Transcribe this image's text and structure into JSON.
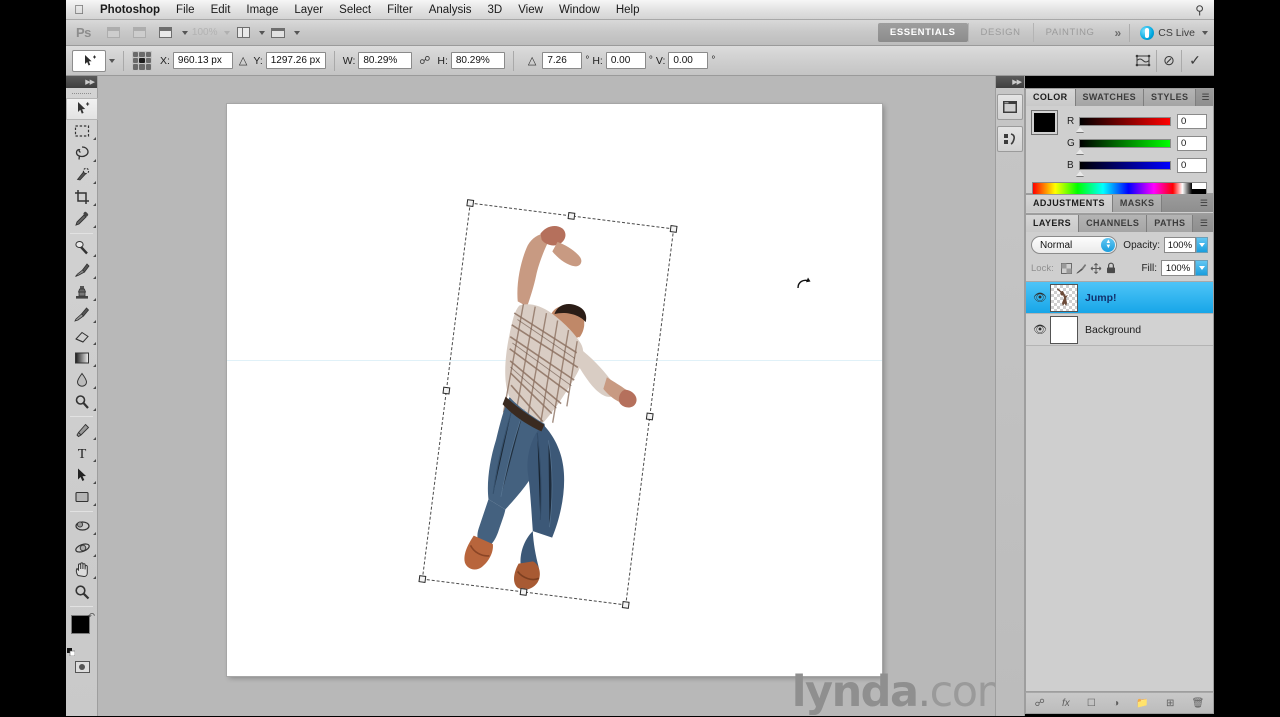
{
  "menubar": {
    "apple": "apple-logo",
    "items": [
      "Photoshop",
      "File",
      "Edit",
      "Image",
      "Layer",
      "Select",
      "Filter",
      "Analysis",
      "3D",
      "View",
      "Window",
      "Help"
    ],
    "spotlight": "search-icon"
  },
  "appbar": {
    "logo": "Ps",
    "zoom_value": "100%",
    "workspaces": [
      "ESSENTIALS",
      "DESIGN",
      "PAINTING"
    ],
    "active_workspace": "ESSENTIALS",
    "more": "»",
    "cs_live": "CS Live"
  },
  "options": {
    "x_label": "X:",
    "x_value": "960.13 px",
    "y_label": "Y:",
    "y_value": "1297.26 px",
    "w_label": "W:",
    "w_value": "80.29%",
    "h_label": "H:",
    "h_value": "80.29%",
    "angle_value": "7.26",
    "angle_unit": "°",
    "skew_h_label": "H:",
    "skew_h_value": "0.00",
    "skew_h_unit": "°",
    "skew_v_label": "V:",
    "skew_v_value": "0.00",
    "skew_v_unit": "°",
    "delta_symbol": "△",
    "warp_icon": "warp-icon",
    "cancel_icon": "⊘",
    "commit_icon": "✓"
  },
  "tools": [
    {
      "name": "move-tool",
      "selected": true
    },
    {
      "name": "rectangular-marquee-tool",
      "selected": false
    },
    {
      "name": "lasso-tool",
      "selected": false
    },
    {
      "name": "quick-selection-tool",
      "selected": false
    },
    {
      "name": "crop-tool",
      "selected": false
    },
    {
      "name": "eyedropper-tool",
      "selected": false
    },
    {
      "name": "spot-healing-brush-tool",
      "selected": false
    },
    {
      "name": "brush-tool",
      "selected": false
    },
    {
      "name": "clone-stamp-tool",
      "selected": false
    },
    {
      "name": "history-brush-tool",
      "selected": false
    },
    {
      "name": "eraser-tool",
      "selected": false
    },
    {
      "name": "gradient-tool",
      "selected": false
    },
    {
      "name": "blur-tool",
      "selected": false
    },
    {
      "name": "dodge-tool",
      "selected": false
    },
    {
      "name": "pen-tool",
      "selected": false
    },
    {
      "name": "type-tool",
      "selected": false,
      "glyph": "T"
    },
    {
      "name": "path-selection-tool",
      "selected": false
    },
    {
      "name": "rectangle-shape-tool",
      "selected": false
    },
    {
      "name": "3d-rotate-tool",
      "selected": false
    },
    {
      "name": "3d-orbit-tool",
      "selected": false
    },
    {
      "name": "hand-tool",
      "selected": false
    },
    {
      "name": "zoom-tool",
      "selected": false
    }
  ],
  "toolbox": {
    "foreground_color": "#000000",
    "background_color": "#ffffff",
    "quick_mask": "quick-mask-icon"
  },
  "canvas": {
    "transform_angle_deg": 7.26,
    "watermark_brand": "lynda",
    "watermark_dot": ".",
    "watermark_tld": "com"
  },
  "dock": {
    "icons": [
      "mini-bridge-icon",
      "histogram-icon"
    ]
  },
  "color_panel": {
    "tabs": [
      "COLOR",
      "SWATCHES",
      "STYLES"
    ],
    "active_tab": "COLOR",
    "channels": [
      {
        "label": "R",
        "value": "0"
      },
      {
        "label": "G",
        "value": "0"
      },
      {
        "label": "B",
        "value": "0"
      }
    ]
  },
  "adjustments_panel": {
    "tabs": [
      "ADJUSTMENTS",
      "MASKS"
    ],
    "active_tab": "ADJUSTMENTS"
  },
  "layers_panel": {
    "tabs": [
      "LAYERS",
      "CHANNELS",
      "PATHS"
    ],
    "active_tab": "LAYERS",
    "blend_mode": "Normal",
    "opacity_label": "Opacity:",
    "opacity_value": "100%",
    "lock_label": "Lock:",
    "fill_label": "Fill:",
    "fill_value": "100%",
    "layers": [
      {
        "name": "Jump!",
        "selected": true,
        "visible": true,
        "type": "transparent"
      },
      {
        "name": "Background",
        "selected": false,
        "visible": true,
        "type": "white"
      }
    ],
    "footer_icons": [
      "link-layers-icon",
      "layer-fx-icon",
      "layer-mask-icon",
      "adjustment-layer-icon",
      "new-group-icon",
      "new-layer-icon",
      "delete-layer-icon"
    ]
  }
}
